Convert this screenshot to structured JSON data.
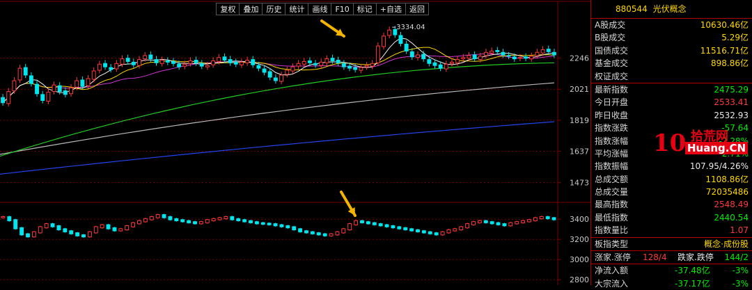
{
  "toolbar": {
    "buttons": [
      "复权",
      "叠加",
      "历史",
      "统计",
      "画线",
      "F10",
      "标记",
      "+自选",
      "返回"
    ]
  },
  "colors": {
    "candle_up": "#ff3a3a",
    "candle_down": "#00e5ee",
    "ma_short": "#f2f2f2",
    "ma_mid": "#ffd800",
    "ma_long1": "#d236d2",
    "ma_long2": "#22cc22",
    "ma_long3": "#b8b8b8",
    "ma_long4": "#2244ee",
    "grid": "#7a0000",
    "axis_text": "#c8c8c8",
    "annotation_arrow": "#f5b400"
  },
  "chart_data": [
    {
      "type": "candlestick",
      "panel": "price",
      "y_ticks": [
        "2246",
        "2021",
        "1819",
        "1637",
        "1473"
      ],
      "max_label": "3334.04",
      "yscale": "log",
      "ylim": [
        1380,
        2560
      ],
      "moving_average_trend": {
        "gray_start": 1620,
        "gray_end": 2065,
        "blue_start": 1515,
        "blue_end": 1810,
        "green_start": 1610,
        "green_end": 2210
      },
      "closes": [
        1930,
        2005,
        2080,
        2170,
        2120,
        2060,
        1990,
        1945,
        2000,
        2050,
        2005,
        1985,
        2030,
        2080,
        2040,
        2095,
        2150,
        2200,
        2180,
        2160,
        2205,
        2240,
        2220,
        2195,
        2235,
        2265,
        2240,
        2210,
        2230,
        2215,
        2205,
        2180,
        2200,
        2225,
        2210,
        2185,
        2190,
        2225,
        2250,
        2230,
        2210,
        2200,
        2215,
        2230,
        2195,
        2170,
        2140,
        2105,
        2080,
        2120,
        2155,
        2180,
        2205,
        2220,
        2210,
        2195,
        2215,
        2240,
        2225,
        2210,
        2180,
        2170,
        2160,
        2175,
        2190,
        2205,
        2340,
        2420,
        2470,
        2430,
        2360,
        2300,
        2255,
        2270,
        2240,
        2205,
        2190,
        2170,
        2200,
        2215,
        2235,
        2250,
        2265,
        2240,
        2260,
        2290,
        2300,
        2295,
        2270,
        2260,
        2240,
        2250,
        2245,
        2260,
        2290,
        2310,
        2295,
        2270
      ],
      "opens": [
        1965,
        1925,
        2010,
        2085,
        2175,
        2115,
        2055,
        1985,
        1940,
        2005,
        2045,
        2010,
        1990,
        2035,
        2085,
        2045,
        2090,
        2155,
        2205,
        2175,
        2165,
        2200,
        2245,
        2215,
        2190,
        2240,
        2270,
        2235,
        2205,
        2225,
        2220,
        2200,
        2185,
        2205,
        2230,
        2205,
        2180,
        2195,
        2220,
        2255,
        2235,
        2215,
        2195,
        2210,
        2235,
        2190,
        2165,
        2145,
        2100,
        2075,
        2125,
        2150,
        2185,
        2200,
        2225,
        2205,
        2190,
        2210,
        2245,
        2230,
        2205,
        2185,
        2175,
        2155,
        2180,
        2185,
        2210,
        2335,
        2425,
        2475,
        2425,
        2355,
        2295,
        2250,
        2275,
        2235,
        2210,
        2195,
        2165,
        2205,
        2210,
        2240,
        2245,
        2270,
        2235,
        2265,
        2285,
        2305,
        2290,
        2265,
        2255,
        2245,
        2255,
        2240,
        2265,
        2285,
        2315,
        2290
      ]
    },
    {
      "type": "candlestick",
      "panel": "lower",
      "y_ticks": [
        "3400",
        "3200",
        "3000",
        "2800"
      ],
      "ylim": [
        2760,
        3560
      ],
      "closes": [
        3420,
        3390,
        3310,
        3250,
        3230,
        3270,
        3320,
        3350,
        3330,
        3300,
        3280,
        3260,
        3240,
        3230,
        3270,
        3320,
        3340,
        3310,
        3290,
        3300,
        3330,
        3360,
        3380,
        3400,
        3420,
        3440,
        3420,
        3400,
        3390,
        3380,
        3370,
        3360,
        3370,
        3390,
        3400,
        3410,
        3420,
        3400,
        3390,
        3380,
        3370,
        3360,
        3355,
        3350,
        3340,
        3330,
        3320,
        3300,
        3280,
        3270,
        3260,
        3250,
        3240,
        3250,
        3270,
        3300,
        3350,
        3380,
        3370,
        3360,
        3350,
        3340,
        3330,
        3320,
        3310,
        3300,
        3290,
        3280,
        3270,
        3260,
        3250,
        3270,
        3290,
        3300,
        3320,
        3350,
        3370,
        3380,
        3370,
        3360,
        3350,
        3340,
        3360,
        3370,
        3380,
        3390,
        3410,
        3420,
        3410,
        3400
      ]
    }
  ],
  "panel": {
    "code": "880544",
    "name": "光伏概念",
    "rows1": [
      {
        "label": "A股成交",
        "value": "10630.46亿",
        "color": "yellow"
      },
      {
        "label": "B股成交",
        "value": "5.29亿",
        "color": "yellow"
      },
      {
        "label": "国债成交",
        "value": "11516.71亿",
        "color": "yellow"
      },
      {
        "label": "基金成交",
        "value": "898.86亿",
        "color": "yellow"
      },
      {
        "label": "权证成交",
        "value": "",
        "color": "yellow"
      }
    ],
    "rows2": [
      {
        "label": "最新指数",
        "value": "2475.29",
        "color": "green"
      },
      {
        "label": "今日开盘",
        "value": "2533.41",
        "color": "red"
      },
      {
        "label": "昨日收盘",
        "value": "2532.93",
        "color": "white"
      },
      {
        "label": "指数涨跌",
        "value": "-57.64",
        "color": "green"
      },
      {
        "label": "指数涨幅",
        "value": "-2.28%",
        "color": "green"
      },
      {
        "label": "平均涨幅",
        "value": "-2.71%",
        "color": "green"
      },
      {
        "label": "指数振幅",
        "value": "107.95/4.26%",
        "color": "white"
      },
      {
        "label": "总成交额",
        "value": "1108.86亿",
        "color": "yellow"
      },
      {
        "label": "总成交量",
        "value": "72035486",
        "color": "yellow"
      },
      {
        "label": "最高指数",
        "value": "2548.49",
        "color": "red"
      },
      {
        "label": "最低指数",
        "value": "2440.54",
        "color": "green"
      },
      {
        "label": "指数量比",
        "value": "1.07",
        "color": "red"
      }
    ],
    "board_type_label": "板指类型",
    "board_type_value": "概念·成份股",
    "row_up": {
      "label": "涨家.涨停",
      "value_red": "128/4",
      "label2": "跌家.跌停",
      "value_green": "144/2"
    },
    "rows3": [
      {
        "label": "净流入额",
        "value": "-37.48亿",
        "pct": "-3%"
      },
      {
        "label": "大宗流入",
        "value": "-37.17亿",
        "pct": "-3%"
      }
    ]
  },
  "watermark": {
    "ten": "10",
    "cn": "拾荒网",
    "en": "Huang.CN"
  }
}
